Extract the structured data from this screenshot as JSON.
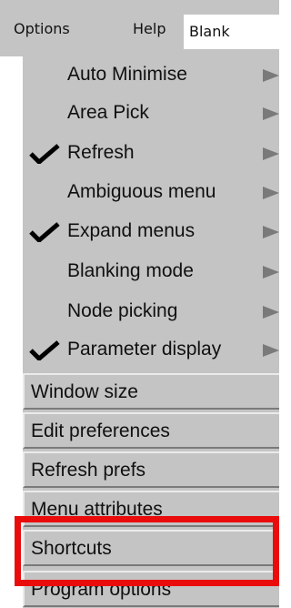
{
  "menubar": {
    "options_label": "Options",
    "help_label": "Help",
    "field_value": "Blank"
  },
  "dropdown": {
    "options": [
      {
        "label": "Auto Minimise",
        "checked": false,
        "submenu_icon": "triangle-right-icon"
      },
      {
        "label": "Area Pick",
        "checked": false,
        "submenu_icon": "triangle-right-icon"
      },
      {
        "label": "Refresh",
        "checked": true,
        "submenu_icon": "triangle-right-icon"
      },
      {
        "label": "Ambiguous menu",
        "checked": false,
        "submenu_icon": "triangle-right-icon"
      },
      {
        "label": "Expand menus",
        "checked": true,
        "submenu_icon": "triangle-right-icon"
      },
      {
        "label": "Blanking mode",
        "checked": false,
        "submenu_icon": "triangle-right-icon"
      },
      {
        "label": "Node picking",
        "checked": false,
        "submenu_icon": "triangle-right-icon"
      },
      {
        "label": "Parameter display",
        "checked": true,
        "submenu_icon": "triangle-right-icon"
      }
    ],
    "actions": [
      {
        "label": "Window size"
      },
      {
        "label": "Edit preferences"
      },
      {
        "label": "Refresh prefs"
      },
      {
        "label": "Menu attributes"
      },
      {
        "label": "Shortcuts"
      },
      {
        "label": "Program options"
      }
    ]
  },
  "colors": {
    "menu_background": "#c4c4c4",
    "highlight_border": "#ea0b0b",
    "checkmark": "#000000",
    "arrow": "#7a7a7a"
  }
}
